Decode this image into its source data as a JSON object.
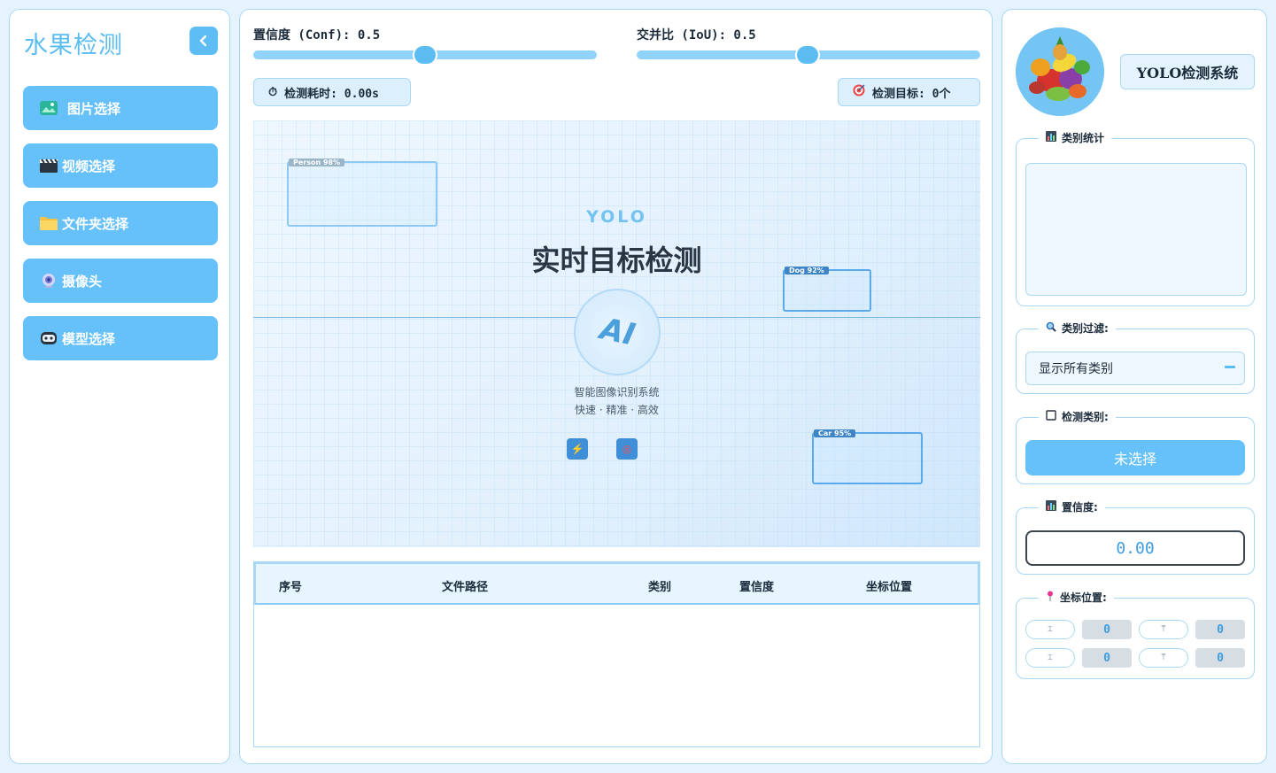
{
  "sidebar": {
    "brand": "水果检测",
    "items": [
      {
        "label": "图片选择",
        "icon": "image-icon"
      },
      {
        "label": "视频选择",
        "icon": "clapperboard-icon"
      },
      {
        "label": "文件夹选择",
        "icon": "folder-icon"
      },
      {
        "label": "摄像头",
        "icon": "webcam-icon"
      },
      {
        "label": "模型选择",
        "icon": "robot-icon"
      }
    ],
    "collapse_icon": "chevron-left-icon"
  },
  "controls": {
    "conf_label": "置信度 (Conf): 0.5",
    "conf_value": 0.5,
    "iou_label": "交并比 (IoU): 0.5",
    "iou_value": 0.5,
    "time_label": "检测耗时: 0.00s",
    "target_label": "检测目标: 0个"
  },
  "preview": {
    "yolo": "YOLO",
    "title": "实时目标检测",
    "ai": "AI",
    "subtitle": "智能图像识别系统",
    "tagline": "快速 · 精准 · 高效",
    "boxes": [
      {
        "label": "Person 98%"
      },
      {
        "label": "Dog 92%"
      },
      {
        "label": "Car 95%"
      }
    ]
  },
  "table": {
    "headers": [
      "序号",
      "文件路径",
      "类别",
      "置信度",
      "坐标位置"
    ],
    "rows": []
  },
  "right": {
    "system_title": "YOLO检测系统",
    "stats_title": "类别统计",
    "filter_title": "类别过滤:",
    "filter_value": "显示所有类别",
    "class_title": "检测类别:",
    "class_button": "未选择",
    "conf_title": "置信度:",
    "conf_value": "0.00",
    "coord_title": "坐标位置:",
    "coords": {
      "xmin_label": "⌶",
      "xmin": "0",
      "ymin_label": "⍑",
      "ymin": "0",
      "xmax_label": "⌶",
      "xmax": "0",
      "ymax_label": "⍑",
      "ymax": "0"
    }
  },
  "colors": {
    "accent": "#66c1fb",
    "brand_text": "#5bbcf2",
    "border": "#a9d8f7",
    "background": "#e4f3fd"
  }
}
